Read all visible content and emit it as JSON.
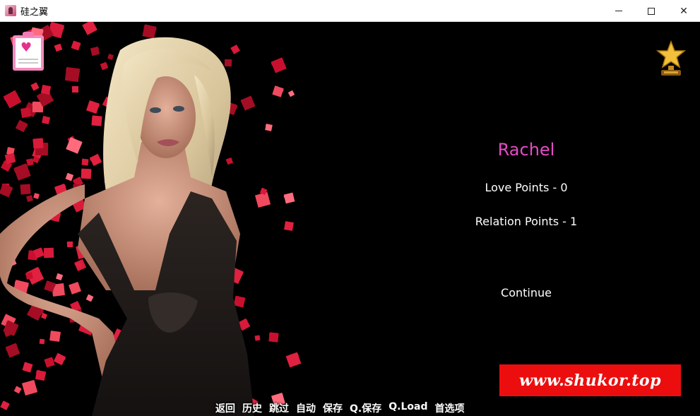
{
  "window": {
    "title": "硅之翼",
    "minimize_icon": "minimize-icon",
    "maximize_icon": "maximize-icon",
    "close_icon": "close-icon",
    "close_glyph": "✕"
  },
  "hud": {
    "journal_icon": "clipboard-heart-icon",
    "achievements_icon": "trophy-star-icon"
  },
  "character": {
    "name": "Rachel",
    "name_color": "#e54bc5",
    "love_points_text": "Love Points - 0",
    "love_points": 0,
    "relation_points_text": "Relation Points - 1",
    "relation_points": 1
  },
  "actions": {
    "continue_label": "Continue"
  },
  "watermark": {
    "text": "www.shukor.top",
    "color": "#ec0e0e"
  },
  "quick_menu": {
    "back": "返回",
    "history": "历史",
    "skip": "跳过",
    "auto": "自动",
    "save": "保存",
    "quick_save": "Q.保存",
    "quick_load": "Q.Load",
    "preferences": "首选项"
  }
}
